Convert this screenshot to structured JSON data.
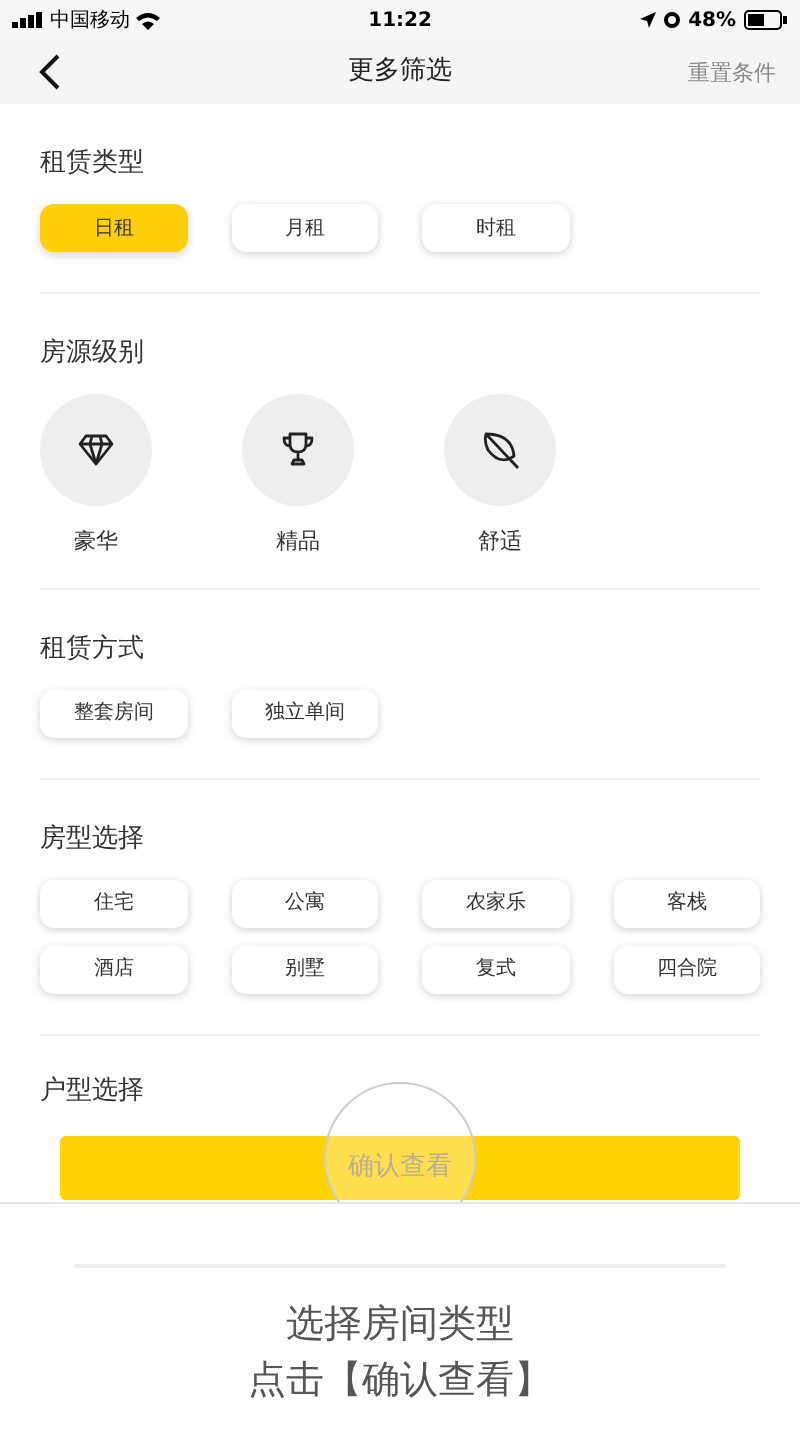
{
  "status_bar": {
    "carrier": "中国移动",
    "time": "11:22",
    "battery": "48%"
  },
  "nav": {
    "title": "更多筛选",
    "action": "重置条件"
  },
  "sections": [
    {
      "kind": "chips",
      "title": "租赁类型",
      "options": [
        {
          "label": "日租",
          "selected": true
        },
        {
          "label": "月租",
          "selected": false
        },
        {
          "label": "时租",
          "selected": false
        }
      ]
    },
    {
      "kind": "levels",
      "title": "房源级别",
      "options": [
        {
          "label": "豪华"
        },
        {
          "label": "精品"
        },
        {
          "label": "舒适"
        }
      ]
    },
    {
      "kind": "chips",
      "title": "租赁方式",
      "options": [
        {
          "label": "整套房间",
          "selected": false
        },
        {
          "label": "独立单间",
          "selected": false
        }
      ]
    },
    {
      "kind": "chips",
      "title": "房型选择",
      "options": [
        {
          "label": "住宅",
          "selected": false
        },
        {
          "label": "公寓",
          "selected": false
        },
        {
          "label": "农家乐",
          "selected": false
        },
        {
          "label": "客栈",
          "selected": false
        },
        {
          "label": "酒店",
          "selected": false
        },
        {
          "label": "别墅",
          "selected": false
        },
        {
          "label": "复式",
          "selected": false
        },
        {
          "label": "四合院",
          "selected": false
        }
      ]
    },
    {
      "kind": "covered",
      "title": "户型选择"
    }
  ],
  "confirm_button": "确认查看",
  "caption": [
    "选择房间类型",
    "点击【确认查看】"
  ]
}
